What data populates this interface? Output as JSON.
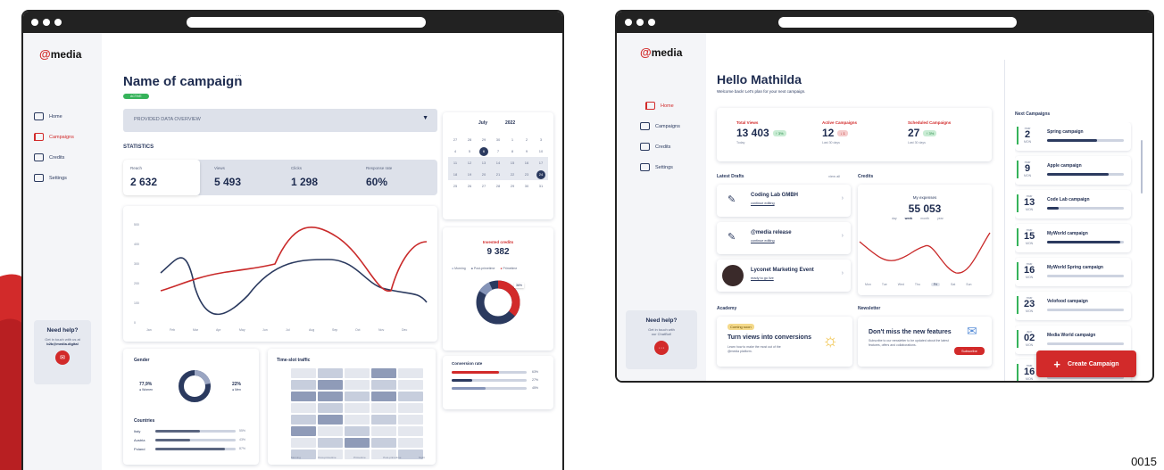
{
  "page_number": "0015",
  "colors": {
    "brand_red": "#d22a2a",
    "navy": "#2b3a5f",
    "green": "#36b35a"
  },
  "left": {
    "logo": {
      "at": "@",
      "text": "media"
    },
    "nav": [
      {
        "label": "Home",
        "icon": "home-icon",
        "active": false
      },
      {
        "label": "Campaigns",
        "icon": "grid-icon",
        "active": true
      },
      {
        "label": "Credits",
        "icon": "card-icon",
        "active": false
      },
      {
        "label": "Settings",
        "icon": "sliders-icon",
        "active": false
      }
    ],
    "help": {
      "title": "Need help?",
      "text1": "Get in touch with us at",
      "text2": "b2b@media.digital"
    },
    "campaign_title": "Name of campaign",
    "more": "...",
    "status": "ACTIVE",
    "data_overview": "PROVIDED DATA OVERVIEW",
    "statistics_label": "STATISTICS",
    "stats": [
      {
        "label": "Reach",
        "value": "2 632"
      },
      {
        "label": "Views",
        "value": "5 493"
      },
      {
        "label": "Clicks",
        "value": "1 298"
      },
      {
        "label": "Response rate",
        "value": "60%"
      }
    ],
    "line_chart": {
      "months": [
        "Jan",
        "Feb",
        "Mar",
        "Apr",
        "May",
        "Jun",
        "Jul",
        "Aug",
        "Sep",
        "Oct",
        "Nov",
        "Dec"
      ],
      "y_ticks": [
        "500",
        "400",
        "300",
        "200",
        "100",
        "0"
      ]
    },
    "calendar": {
      "month": "July",
      "year": "2022",
      "rows": [
        [
          "27",
          "28",
          "29",
          "30",
          "1",
          "2",
          "3"
        ],
        [
          "4",
          "5",
          "6",
          "7",
          "8",
          "9",
          "10"
        ],
        [
          "11",
          "12",
          "13",
          "14",
          "15",
          "16",
          "17"
        ],
        [
          "18",
          "19",
          "20",
          "21",
          "22",
          "23",
          "24"
        ],
        [
          "25",
          "26",
          "27",
          "28",
          "29",
          "30",
          "31"
        ]
      ]
    },
    "invested": {
      "title": "Invested credits",
      "value": "9 382"
    },
    "legend": [
      "Morning",
      "Post-primetime",
      "Primetime"
    ],
    "donut_label": "36%",
    "conversion": {
      "title": "Conversion rate",
      "rows": [
        {
          "label": "63%",
          "value": 63
        },
        {
          "label": "27%",
          "value": 27
        },
        {
          "label": "45%",
          "value": 45
        }
      ]
    },
    "gender": {
      "title": "Gender",
      "women_pct": "77,9%",
      "women": "Women",
      "men_pct": "22%",
      "men": "Men"
    },
    "countries": {
      "title": "Countries",
      "rows": [
        {
          "name": "Italy",
          "pct": "55%",
          "value": 55
        },
        {
          "name": "Austria",
          "pct": "43%",
          "value": 43
        },
        {
          "name": "Poland",
          "pct": "87%",
          "value": 87
        }
      ]
    },
    "timeslot": {
      "title": "Time-slot traffic",
      "cols": [
        "Morning",
        "Post-primetime",
        "Primetime",
        "Post-primetime",
        "Night"
      ]
    }
  },
  "right": {
    "logo": {
      "at": "@",
      "text": "media"
    },
    "nav": [
      {
        "label": "Home",
        "icon": "home-icon",
        "active": true
      },
      {
        "label": "Campaigns",
        "icon": "grid-icon",
        "active": false
      },
      {
        "label": "Credits",
        "icon": "card-icon",
        "active": false
      },
      {
        "label": "Settings",
        "icon": "sliders-icon",
        "active": false
      }
    ],
    "help": {
      "title": "Need help?",
      "text1": "Get in touch with",
      "text2": "our ChatBot!"
    },
    "greeting": "Hello Mathilda",
    "welcome": "Welcome back! Let's plan for your next campaign.",
    "kpis": [
      {
        "label": "Total Views",
        "value": "13 403",
        "badge": "↑ 3%",
        "badge_color": "green",
        "sub": "Today"
      },
      {
        "label": "Active Campaigns",
        "value": "12",
        "badge": "↓ 1",
        "badge_color": "red",
        "sub": "Last 30 days"
      },
      {
        "label": "Scheduled Campaigns",
        "value": "27",
        "badge": "↑ 3%",
        "badge_color": "green",
        "sub": "Last 30 days"
      }
    ],
    "latest_drafts": "Latest Drafts",
    "view_all": "view all",
    "drafts": [
      {
        "title": "Coding Lab GMBH",
        "action": "continue editing",
        "icon": "edit-icon"
      },
      {
        "title": "@media release",
        "action": "continue editing",
        "icon": "edit-icon"
      },
      {
        "title": "Lyconet Marketing Event",
        "action": "ready to go live",
        "icon": "avatar"
      }
    ],
    "credits_label": "Credits",
    "expenses": {
      "title": "My expenses",
      "value": "55 053",
      "periods": [
        "day",
        "week",
        "month",
        "year"
      ],
      "days": [
        "Mon",
        "Tue",
        "Wed",
        "Thu",
        "Fri",
        "Sat",
        "Sun"
      ]
    },
    "academy": {
      "label": "Academy",
      "badge": "Coming soon",
      "title": "Turn views into conversions",
      "text": "Learn how to make the most out of the @media platform."
    },
    "newsletter": {
      "label": "Newsletter",
      "title": "Don't miss the new features",
      "text": "Subscribe to our newsletter to be updated about the latest features, offers and collaborations.",
      "button": "Subscribe"
    },
    "next_title": "Next Campaigns",
    "next": [
      {
        "mon": "mar",
        "day": "2",
        "wd": "MON",
        "name": "Spring campaign",
        "progress": 0.65
      },
      {
        "mon": "mar",
        "day": "9",
        "wd": "MON",
        "name": "Apple campaign",
        "progress": 0.8
      },
      {
        "mon": "mar",
        "day": "13",
        "wd": "MON",
        "name": "Code Lab campaign",
        "progress": 0.15
      },
      {
        "mon": "mar",
        "day": "15",
        "wd": "MON",
        "name": "MyWorld campaign",
        "progress": 0.95
      },
      {
        "mon": "mar",
        "day": "16",
        "wd": "MON",
        "name": "MyWorld Spring campaign",
        "progress": 0.0
      },
      {
        "mon": "mar",
        "day": "23",
        "wd": "MON",
        "name": "Velofood campaign",
        "progress": 0.0
      },
      {
        "mon": "apr",
        "day": "02",
        "wd": "MON",
        "name": "Media World campaign",
        "progress": 0.0
      },
      {
        "mon": "mar",
        "day": "16",
        "wd": "MON",
        "name": "",
        "progress": 0.0
      }
    ],
    "create_button": "Create Campaign"
  }
}
